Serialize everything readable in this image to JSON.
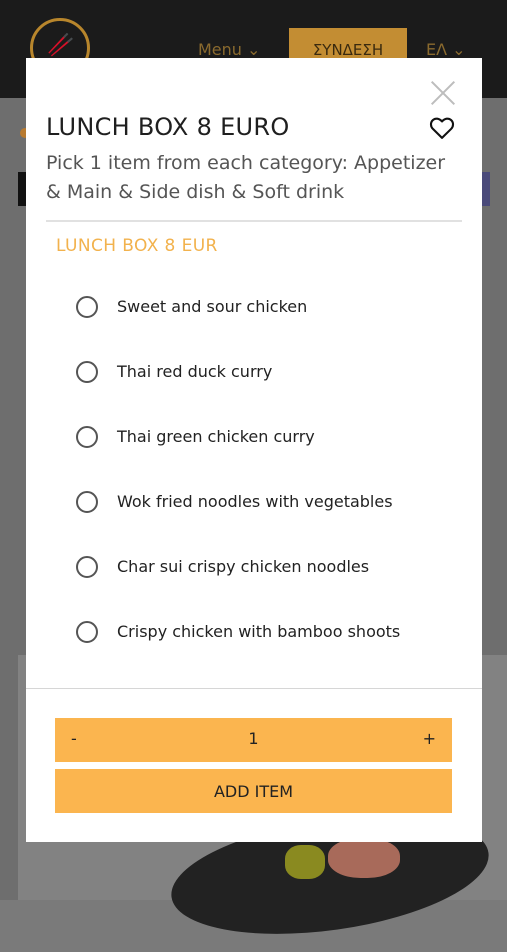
{
  "background": {
    "nav_menu": "Menu ⌄",
    "login": "ΣΥΝΔΕΣΗ",
    "language": "ΕΛ ⌄"
  },
  "modal": {
    "title": "LUNCH BOX 8 EURO",
    "subtitle": "Pick 1 item from each category: Appetizer & Main & Side dish & Soft drink",
    "section_title": "LUNCH BOX 8 EUR",
    "options": [
      {
        "label": "Sweet and sour chicken"
      },
      {
        "label": "Thai red duck curry"
      },
      {
        "label": "Thai green chicken curry"
      },
      {
        "label": "Wok fried noodles with vegetables"
      },
      {
        "label": "Char sui crispy chicken noodles"
      },
      {
        "label": "Crispy chicken with bamboo shoots"
      },
      {
        "label": ""
      }
    ],
    "quantity": {
      "minus": "-",
      "value": "1",
      "plus": "+"
    },
    "add_item": "ADD ITEM"
  },
  "colors": {
    "accent": "#fbb54f",
    "section_title": "#f2b24d"
  }
}
